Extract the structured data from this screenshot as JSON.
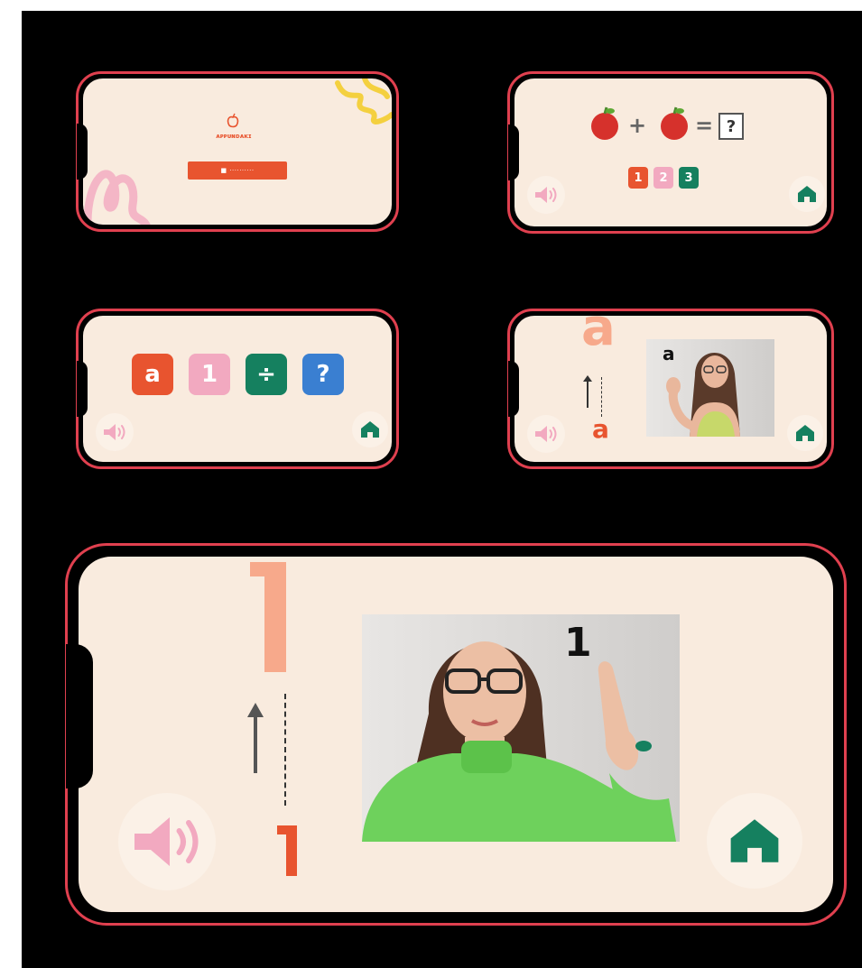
{
  "colors": {
    "accent": "#e8542f",
    "pink": "#f2a9c0",
    "green": "#15805f",
    "blue": "#3a7fd1",
    "peach": "#f7a98b",
    "cream": "#f9ebde",
    "frame": "#e0404f"
  },
  "screen1": {
    "logo_text": "ᴀᴘᴘᴜɴᴅᴀᴋɪ",
    "start_label": "■ ··········"
  },
  "screen2": {
    "plus": "+",
    "equals": "=",
    "question": "?",
    "options": [
      "1",
      "2",
      "3"
    ]
  },
  "screen3": {
    "tiles": [
      "a",
      "1",
      "÷",
      "?"
    ]
  },
  "screen4": {
    "big_letter": "a",
    "small_letter": "a",
    "photo_label": "a"
  },
  "screen5": {
    "big_number": "1",
    "small_number": "1",
    "photo_label": "1"
  },
  "icons": {
    "sound": "speaker-icon",
    "home": "home-icon"
  }
}
